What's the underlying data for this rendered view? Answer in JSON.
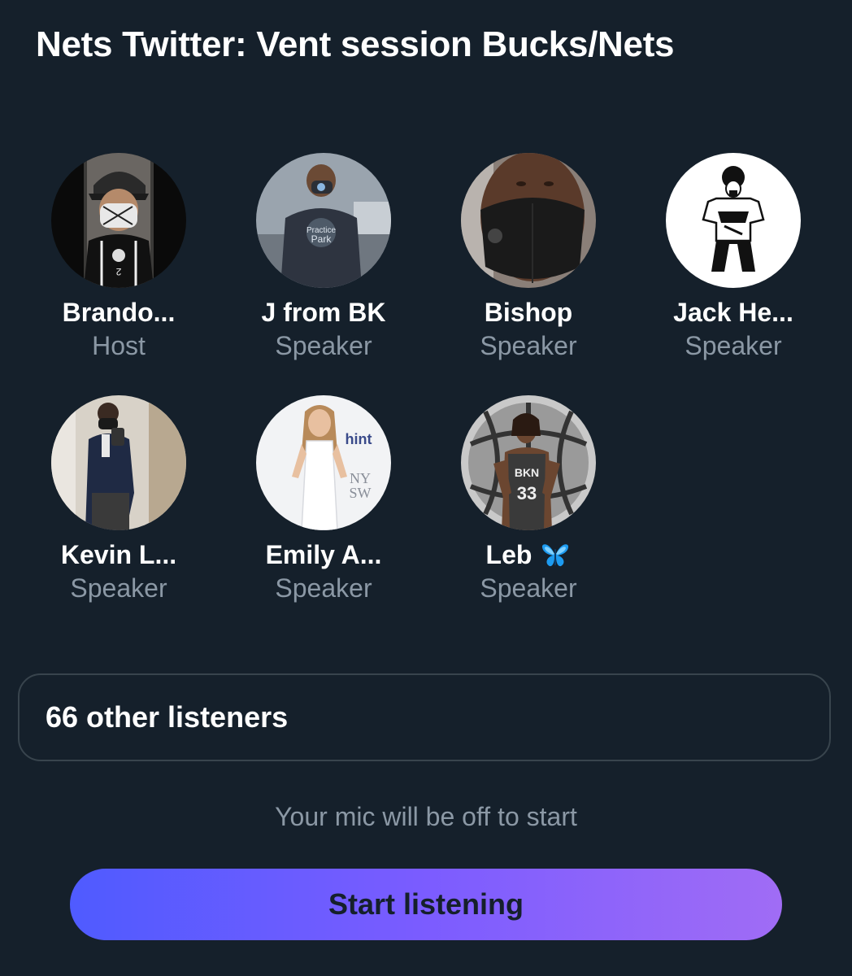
{
  "space": {
    "title": "Nets Twitter: Vent session Bucks/Nets"
  },
  "participants": [
    {
      "name": "Brando...",
      "role": "Host",
      "avatar": "avatar-photo-man-mask-nets-jersey"
    },
    {
      "name": "J from BK",
      "role": "Speaker",
      "avatar": "avatar-photo-man-mask-practice-park-shirt"
    },
    {
      "name": "Bishop",
      "role": "Speaker",
      "avatar": "avatar-photo-man-black-mask"
    },
    {
      "name": "Jack He...",
      "role": "Speaker",
      "avatar": "avatar-illustration-black-white"
    },
    {
      "name": "Kevin L...",
      "role": "Speaker",
      "avatar": "avatar-photo-man-mirror-selfie"
    },
    {
      "name": "Emily A...",
      "role": "Speaker",
      "avatar": "avatar-photo-woman-white-dress"
    },
    {
      "name": "Leb",
      "role": "Speaker",
      "avatar": "avatar-photo-basketball-player-nets-33",
      "name_emoji": "butterfly-icon"
    }
  ],
  "listeners": {
    "label": "66 other listeners"
  },
  "mic_note": "Your mic will be off to start",
  "start_button": {
    "label": "Start listening"
  },
  "colors": {
    "background": "#15202b",
    "secondary_text": "#8b98a5",
    "border": "#38444d",
    "button_gradient_start": "#4f5bff",
    "button_gradient_end": "#a06cf5",
    "butterfly": "#1d9bf0"
  }
}
